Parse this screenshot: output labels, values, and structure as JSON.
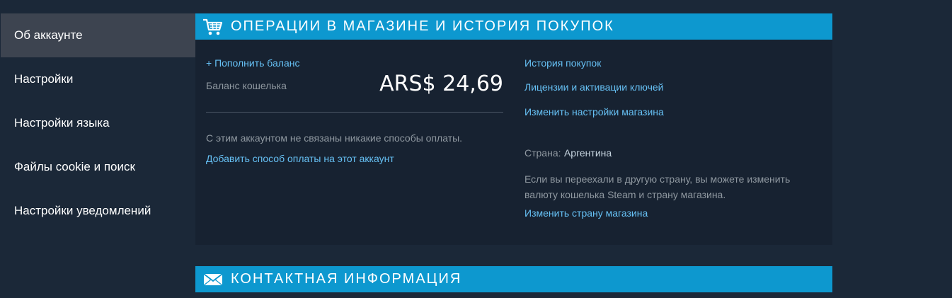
{
  "sidebar": {
    "items": [
      {
        "label": "Об аккаунте"
      },
      {
        "label": "Настройки"
      },
      {
        "label": "Настройки языка"
      },
      {
        "label": "Файлы cookie и поиск"
      },
      {
        "label": "Настройки уведомлений"
      }
    ]
  },
  "store_section": {
    "title": "Операции в магазине и история покупок",
    "icon": "cart-icon",
    "add_funds_label": "+ Пополнить баланс",
    "wallet_label": "Баланс кошелька",
    "wallet_value": "ARS$ 24,69",
    "no_payment_text": "С этим аккаунтом не связаны никакие способы оплаты.",
    "add_payment_link": "Добавить способ оплаты на этот аккаунт",
    "purchase_history_link": "История покупок",
    "licenses_link": "Лицензии и активации ключей",
    "store_prefs_link": "Изменить настройки магазина",
    "country_label": "Страна:",
    "country_value": "Аргентина",
    "country_note": "Если вы переехали в другую страну, вы можете изменить валюту кошелька Steam и страну магазина.",
    "change_country_link": "Изменить страну магазина"
  },
  "contact_section": {
    "title": "Контактная информация",
    "icon": "envelope-icon"
  },
  "colors": {
    "background": "#1b2838",
    "header": "#0d98cf",
    "panel": "#172231",
    "link": "#66c0f4",
    "muted": "#8f98a0",
    "sidebar_active": "#3d4450"
  }
}
